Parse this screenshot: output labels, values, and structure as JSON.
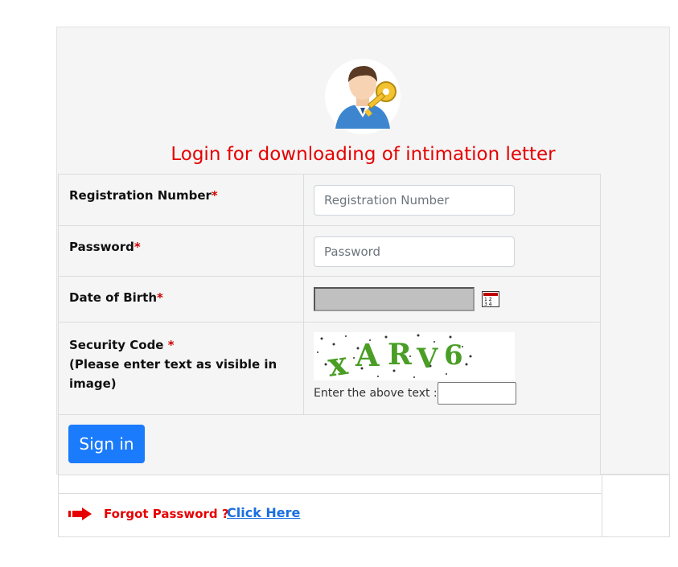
{
  "page_title": "Login for downloading of intimation letter",
  "form": {
    "registration": {
      "label": "Registration Number",
      "required_mark": "*",
      "placeholder": "Registration Number",
      "value": ""
    },
    "password": {
      "label": "Password",
      "required_mark": "*",
      "placeholder": "Password",
      "value": ""
    },
    "dob": {
      "label": "Date of Birth",
      "required_mark": "*",
      "value": ""
    },
    "security": {
      "label": "Security Code",
      "required_mark": "*",
      "hint": "(Please enter text as visible in image)",
      "captcha_text": "XARV6",
      "instruction": "Enter the above text :",
      "value": ""
    }
  },
  "sign_in_label": "Sign in",
  "footer": {
    "forgot_text": "Forgot Password ?",
    "link_text": "Click Here"
  },
  "colors": {
    "accent": "#1a7bfc",
    "title": "#e60000",
    "link": "#1a6fe0"
  },
  "icons": [
    "user-key-icon",
    "calendar-icon",
    "red-arrow-icon"
  ]
}
